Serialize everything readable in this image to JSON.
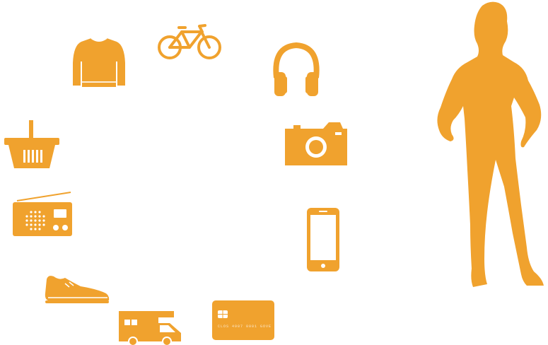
{
  "palette": {
    "accent": "#F0A22E",
    "background": "#ffffff"
  },
  "icons": [
    {
      "name": "sweater-icon"
    },
    {
      "name": "bicycle-icon"
    },
    {
      "name": "headphones-icon"
    },
    {
      "name": "shopping-basket-icon"
    },
    {
      "name": "camera-icon"
    },
    {
      "name": "radio-icon"
    },
    {
      "name": "smartphone-icon"
    },
    {
      "name": "sneaker-icon"
    },
    {
      "name": "camper-van-icon"
    },
    {
      "name": "credit-card-icon"
    },
    {
      "name": "woman-silhouette-icon"
    }
  ],
  "credit_card": {
    "number_text": "CLOS 4907 0001 GOVE"
  }
}
